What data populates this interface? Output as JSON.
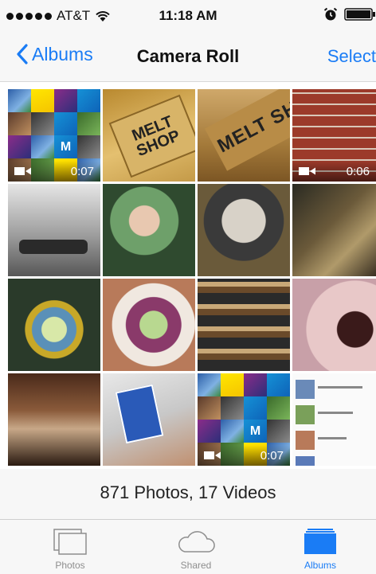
{
  "status_bar": {
    "carrier": "AT&T",
    "time": "11:18 AM"
  },
  "nav": {
    "back_label": "Albums",
    "title": "Camera Roll",
    "select_label": "Select"
  },
  "grid": {
    "thumbnails": [
      {
        "kind": "collage",
        "duration": "0:07",
        "collage_text": "M"
      },
      {
        "kind": "photo",
        "sign_text": "MELT SHOP"
      },
      {
        "kind": "photo",
        "sign_text": "MELT SH"
      },
      {
        "kind": "video",
        "duration": "0:06"
      },
      {
        "kind": "photo"
      },
      {
        "kind": "photo"
      },
      {
        "kind": "photo"
      },
      {
        "kind": "photo"
      },
      {
        "kind": "photo"
      },
      {
        "kind": "photo"
      },
      {
        "kind": "photo"
      },
      {
        "kind": "photo"
      },
      {
        "kind": "photo"
      },
      {
        "kind": "photo"
      },
      {
        "kind": "collage",
        "duration": "0:07",
        "collage_text": "M"
      },
      {
        "kind": "screenshot"
      }
    ]
  },
  "summary": "871 Photos, 17 Videos",
  "tabs": [
    {
      "label": "Photos",
      "icon": "photos-icon"
    },
    {
      "label": "Shared",
      "icon": "cloud-icon"
    },
    {
      "label": "Albums",
      "icon": "albums-icon",
      "active": true
    }
  ],
  "colors": {
    "accent": "#1a7cf5",
    "inactive": "#8e8e8e",
    "bar_bg": "#f7f7f7"
  }
}
